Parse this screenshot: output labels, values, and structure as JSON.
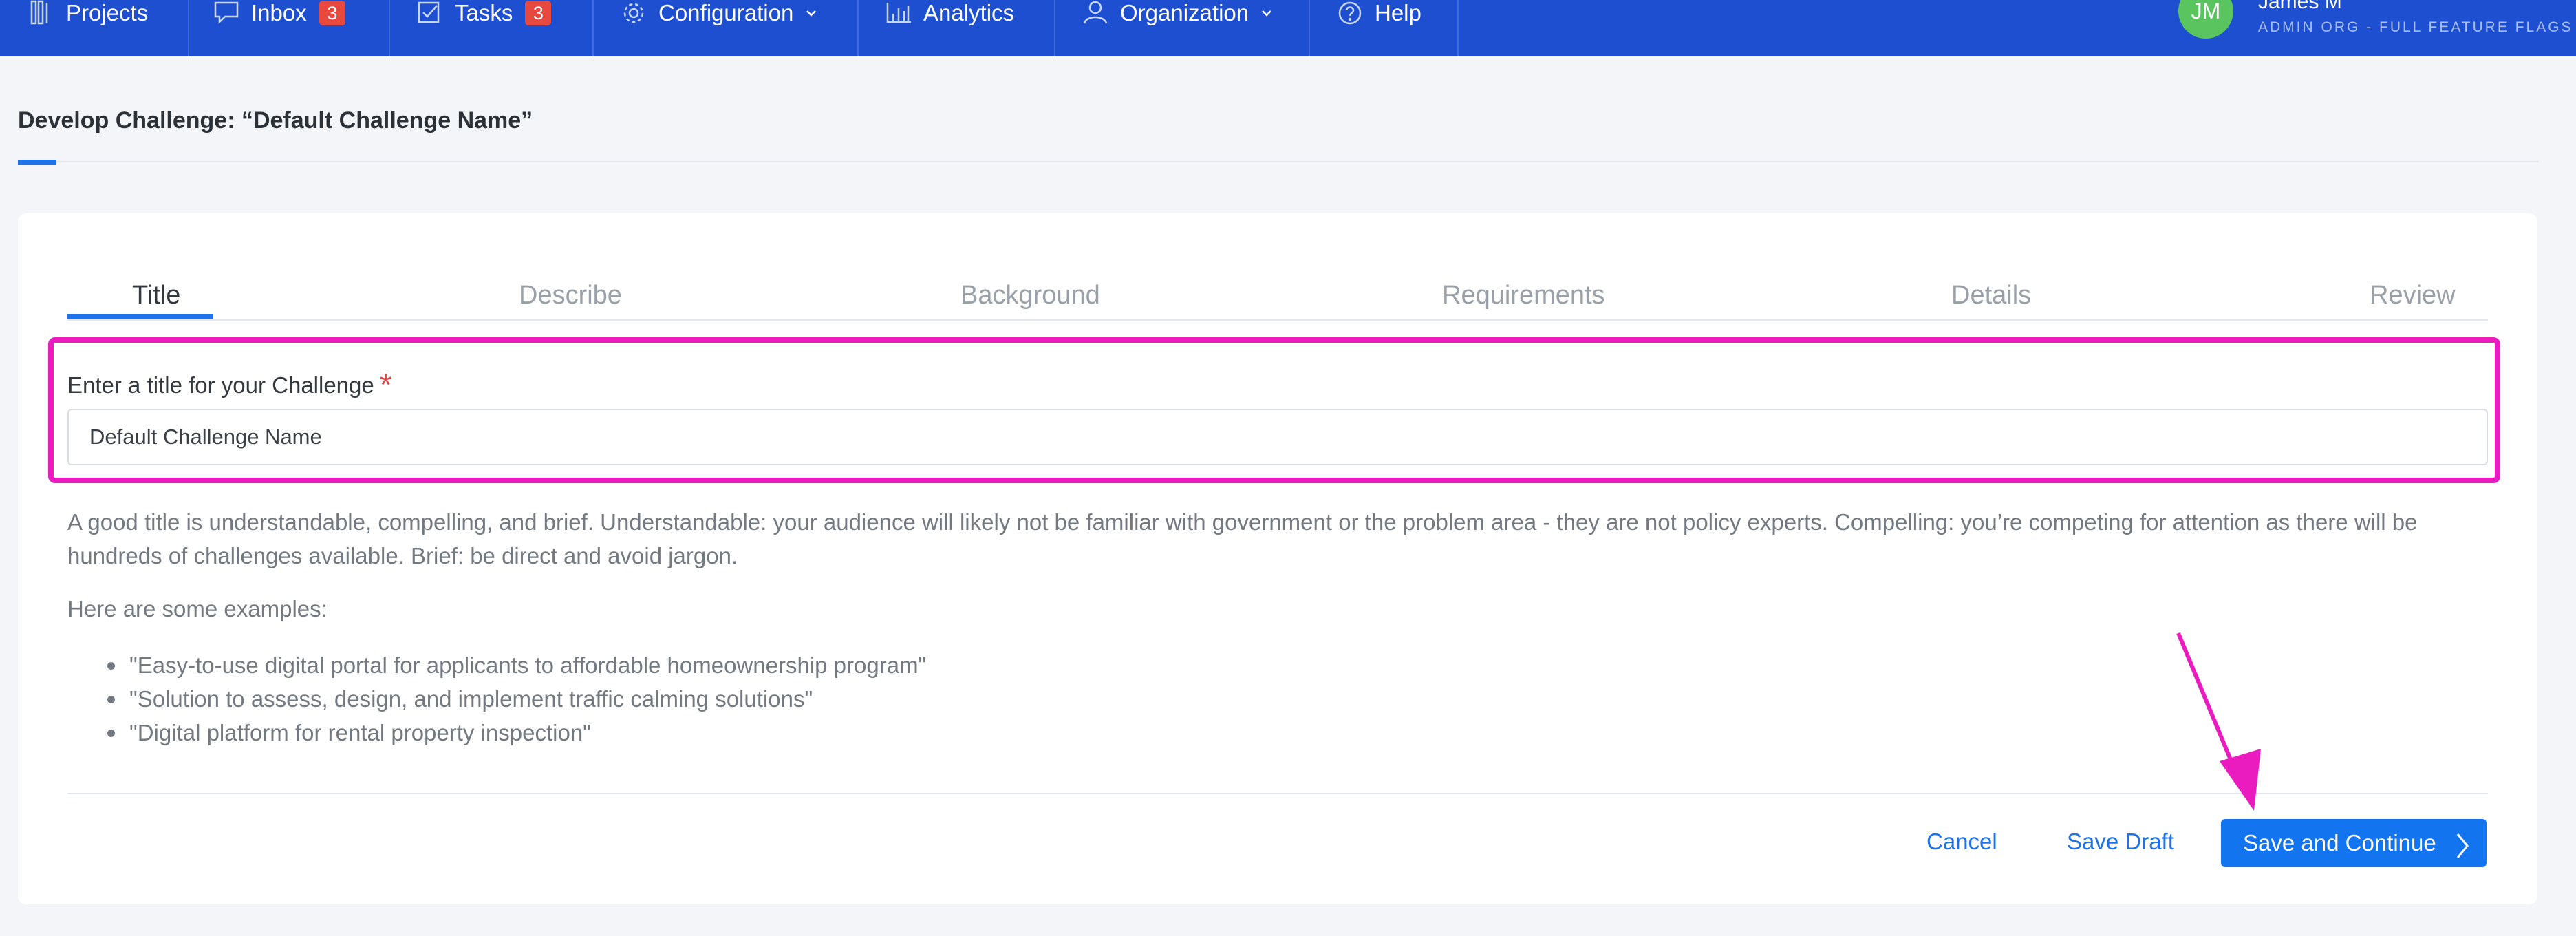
{
  "nav": {
    "items": [
      {
        "label": "Projects",
        "icon": "projects-icon"
      },
      {
        "label": "Inbox",
        "icon": "inbox-icon",
        "badge": "3"
      },
      {
        "label": "Tasks",
        "icon": "tasks-icon",
        "badge": "3"
      },
      {
        "label": "Configuration",
        "icon": "gear-icon",
        "has_caret": true
      },
      {
        "label": "Analytics",
        "icon": "bar-chart-icon"
      },
      {
        "label": "Organization",
        "icon": "user-icon",
        "has_caret": true
      },
      {
        "label": "Help",
        "icon": "help-icon"
      }
    ],
    "user": {
      "initials": "JM",
      "name": "James M",
      "org": "ADMIN ORG - FULL FEATURE FLAGS"
    }
  },
  "page": {
    "title": "Develop Challenge: “Default Challenge Name”"
  },
  "tabs": {
    "title": "Title",
    "describe": "Describe",
    "background": "Background",
    "requirements": "Requirements",
    "details": "Details",
    "review": "Review",
    "active": "Title"
  },
  "form": {
    "label": "Enter a title for your Challenge",
    "required_mark": "*",
    "value": "Default Challenge Name"
  },
  "help": {
    "text": "A good title is understandable, compelling, and brief. Understandable: your audience will likely not be familiar with government or the problem area - they are not policy experts. Compelling: you’re competing for attention as there will be hundreds of challenges available. Brief: be direct and avoid jargon.",
    "examples_intro": "Here are some examples:",
    "examples": [
      "\"Easy-to-use digital portal for applicants to affordable homeownership program\"",
      "\"Solution to assess, design, and implement traffic calming solutions\"",
      "\"Digital platform for rental property inspection\""
    ]
  },
  "actions": {
    "cancel": "Cancel",
    "save_draft": "Save Draft",
    "save_continue": "Save and Continue"
  },
  "colors": {
    "nav_bg": "#1d4fd0",
    "accent": "#1f72e8",
    "badge": "#e8493f",
    "avatar": "#5ac45f",
    "annotation": "#ea1bbf"
  }
}
